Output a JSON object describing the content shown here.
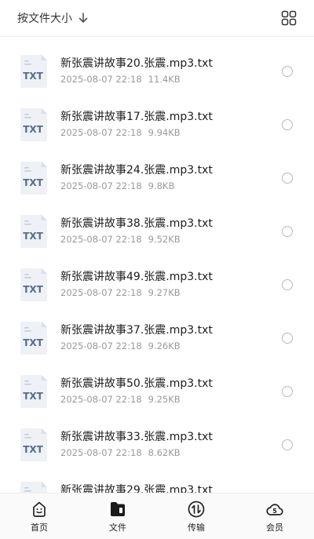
{
  "header": {
    "sort_label": "按文件大小",
    "sort_icon": "arrow-down-icon",
    "view_toggle_icon": "grid-view-icon"
  },
  "file_icon_badge": "TXT",
  "files": [
    {
      "name": "新张震讲故事20.张震.mp3.txt",
      "date": "2025-08-07 22:18",
      "size": "11.4KB"
    },
    {
      "name": "新张震讲故事17.张震.mp3.txt",
      "date": "2025-08-07 22:18",
      "size": "9.94KB"
    },
    {
      "name": "新张震讲故事24.张震.mp3.txt",
      "date": "2025-08-07 22:18",
      "size": "9.8KB"
    },
    {
      "name": "新张震讲故事38.张震.mp3.txt",
      "date": "2025-08-07 22:18",
      "size": "9.52KB"
    },
    {
      "name": "新张震讲故事49.张震.mp3.txt",
      "date": "2025-08-07 22:18",
      "size": "9.27KB"
    },
    {
      "name": "新张震讲故事37.张震.mp3.txt",
      "date": "2025-08-07 22:18",
      "size": "9.26KB"
    },
    {
      "name": "新张震讲故事50.张震.mp3.txt",
      "date": "2025-08-07 22:18",
      "size": "9.25KB"
    },
    {
      "name": "新张震讲故事33.张震.mp3.txt",
      "date": "2025-08-07 22:18",
      "size": "8.62KB"
    },
    {
      "name": "新张震讲故事29.张震.mp3.txt",
      "date": "",
      "size": ""
    }
  ],
  "tabbar": [
    {
      "label": "首页",
      "icon": "home-face-icon",
      "active": false
    },
    {
      "label": "文件",
      "icon": "folder-icon",
      "active": true
    },
    {
      "label": "传输",
      "icon": "transfer-icon",
      "active": false
    },
    {
      "label": "会员",
      "icon": "vip-cloud-icon",
      "active": false
    }
  ],
  "colors": {
    "icon_bg": "#eef1f6",
    "icon_text": "#5b6b88",
    "meta_text": "#9a9a9a",
    "radio_border": "#b9b9b9"
  }
}
